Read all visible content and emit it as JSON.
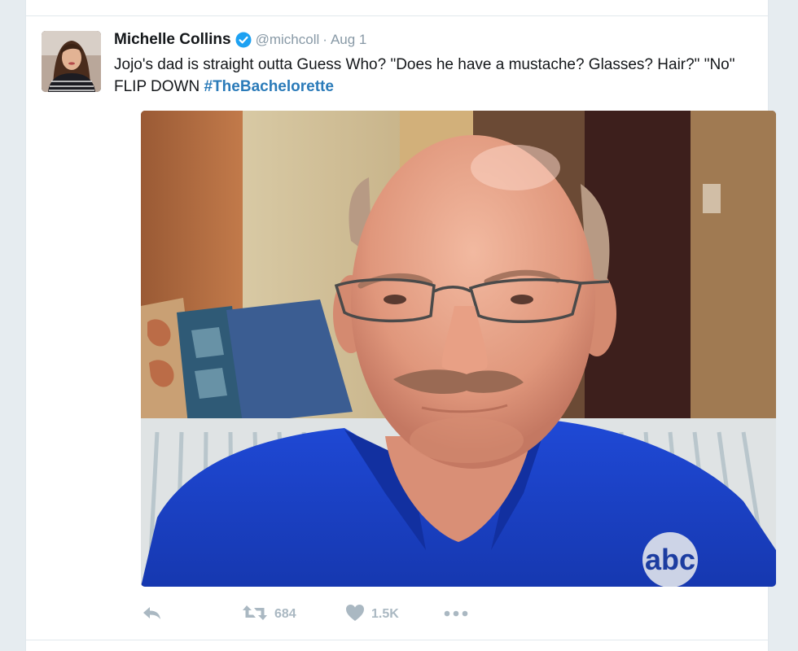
{
  "tweet": {
    "author": {
      "name": "Michelle Collins",
      "handle": "@michcoll",
      "verified": true
    },
    "separator": "·",
    "date": "Aug 1",
    "text": "Jojo's dad is straight outta Guess Who? \"Does he have a mustache? Glasses? Hair?\" \"No\" FLIP DOWN ",
    "hashtag": "#TheBachelorette",
    "media": {
      "watermark": "abc"
    },
    "actions": {
      "reply_icon": "reply-icon",
      "retweet_icon": "retweet-icon",
      "retweet_count": "684",
      "like_icon": "heart-icon",
      "like_count": "1.5K",
      "more_icon": "more-icon"
    }
  },
  "colors": {
    "background": "#e6ecf0",
    "text": "#14171a",
    "muted": "#8899a6",
    "action_gray": "#aab8c2",
    "link": "#2b7bb9",
    "verified": "#1da1f2"
  }
}
